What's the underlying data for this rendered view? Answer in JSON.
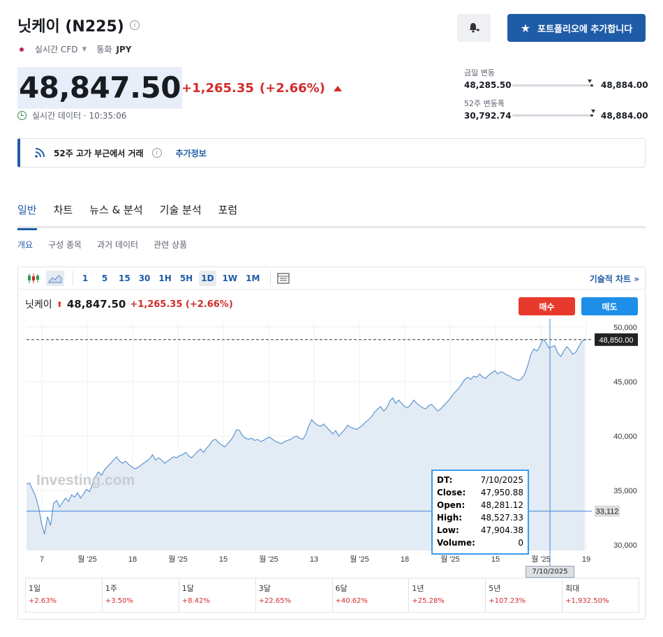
{
  "header": {
    "title": "닛케이 (N225)",
    "sub_type": "실시간 CFD",
    "currency_label": "통화",
    "currency": "JPY",
    "portfolio_button": "포트폴리오에 추가합니다"
  },
  "quote": {
    "price": "48,847.50",
    "change": "+1,265.35",
    "change_pct": "(+2.66%)",
    "realtime": "실시간 데이터 · 10:35:06"
  },
  "ranges": {
    "day_label": "금일 변동",
    "day_low": "48,285.50",
    "day_high": "48,884.00",
    "week52_label": "52주 변동폭",
    "week52_low": "30,792.74",
    "week52_high": "48,884.00"
  },
  "notice": {
    "text": "52주 고가 부근에서 거래",
    "more": "추가정보"
  },
  "tabs": [
    {
      "label": "일반"
    },
    {
      "label": "차트"
    },
    {
      "label": "뉴스 & 분석"
    },
    {
      "label": "기술 분석"
    },
    {
      "label": "포럼"
    }
  ],
  "subtabs": [
    {
      "label": "개요"
    },
    {
      "label": "구성 종목"
    },
    {
      "label": "과거 데이터"
    },
    {
      "label": "관련 상품"
    }
  ],
  "toolbar": {
    "intervals": [
      "1",
      "5",
      "15",
      "30",
      "1H",
      "5H",
      "1D",
      "1W",
      "1M"
    ],
    "active_interval": "1D",
    "tech_chart": "기술적 차트 »"
  },
  "chart_head": {
    "name": "닛케이",
    "price": "48,847.50",
    "change": "+1,265.35 (+2.66%)",
    "buy": "매수",
    "sell": "매도"
  },
  "chart_data": {
    "type": "area",
    "watermark": "Investing.com",
    "y_ticks": [
      "50,000",
      "45,000",
      "40,000",
      "35,000",
      "30,000"
    ],
    "ylim": [
      29500,
      50500
    ],
    "price_label": "48,850.00",
    "cursor_label": "33,112",
    "x_ticks": [
      "7",
      "월 '25",
      "18",
      "월 '25",
      "15",
      "월 '25",
      "13",
      "월 '25",
      "18",
      "월 '25",
      "15",
      "월 '25",
      "19"
    ],
    "cursor_date": "7/10/2025",
    "series": [
      {
        "values": [
          35600,
          35700,
          35100,
          34500,
          33500,
          32000,
          31000,
          32600,
          31800,
          33800,
          34100,
          33500,
          33900,
          34300,
          34000,
          34600,
          34400,
          34800,
          34300,
          34700,
          35100,
          34900,
          35600,
          36300,
          36700,
          36400,
          36900,
          37200,
          37500,
          37800,
          38100,
          37700,
          37500,
          37700,
          37400,
          37200,
          37000,
          37100,
          37300,
          37500,
          37700,
          37900,
          38300,
          37800,
          38000,
          37800,
          37500,
          37700,
          37900,
          38100,
          38000,
          38200,
          38300,
          38500,
          38200,
          38000,
          38300,
          38600,
          38800,
          38500,
          38900,
          39200,
          39600,
          39700,
          39400,
          39200,
          39000,
          39300,
          39600,
          40000,
          40600,
          40500,
          40000,
          39800,
          39700,
          39800,
          39600,
          39700,
          39500,
          39600,
          39800,
          39900,
          39700,
          39500,
          39400,
          39300,
          39500,
          39600,
          39700,
          39900,
          40000,
          39800,
          39700,
          40100,
          40900,
          41500,
          41200,
          41000,
          40900,
          41100,
          40800,
          40500,
          40200,
          40500,
          40000,
          40300,
          40600,
          41000,
          40800,
          40700,
          40600,
          40800,
          41000,
          41300,
          41500,
          41800,
          42200,
          42500,
          42700,
          42300,
          42600,
          43200,
          43500,
          43000,
          43300,
          43000,
          42700,
          42600,
          42900,
          43300,
          43000,
          42800,
          42600,
          42500,
          42800,
          42900,
          42600,
          42300,
          42500,
          42800,
          43100,
          43400,
          43800,
          44100,
          44400,
          44800,
          45200,
          45400,
          45200,
          45500,
          45400,
          45700,
          45400,
          45300,
          45600,
          45800,
          46000,
          45700,
          45900,
          45800,
          45600,
          45500,
          45300,
          45200,
          45100,
          45300,
          45700,
          46500,
          47500,
          48000,
          47800,
          48200,
          48900,
          48600,
          48100,
          48200,
          48300,
          47600,
          47300,
          47800,
          48200,
          47900,
          47500,
          47700,
          48200,
          48700,
          48850
        ]
      }
    ],
    "tooltip": {
      "DT": "7/10/2025",
      "Close": "47,950.88",
      "Open": "48,281.12",
      "High": "48,527.33",
      "Low": "47,904.38",
      "Volume": "0"
    }
  },
  "performance": [
    {
      "label": "1일",
      "value": "+2.63%"
    },
    {
      "label": "1주",
      "value": "+3.50%"
    },
    {
      "label": "1달",
      "value": "+8.42%"
    },
    {
      "label": "3달",
      "value": "+22.65%"
    },
    {
      "label": "6달",
      "value": "+40.62%"
    },
    {
      "label": "1년",
      "value": "+25.28%"
    },
    {
      "label": "5년",
      "value": "+107.23%"
    },
    {
      "label": "최대",
      "value": "+1,932.50%"
    }
  ],
  "colors": {
    "accent": "#1f5ca8",
    "up": "#d22b2b",
    "buy": "#e8392d",
    "sell": "#1e8fe8"
  }
}
